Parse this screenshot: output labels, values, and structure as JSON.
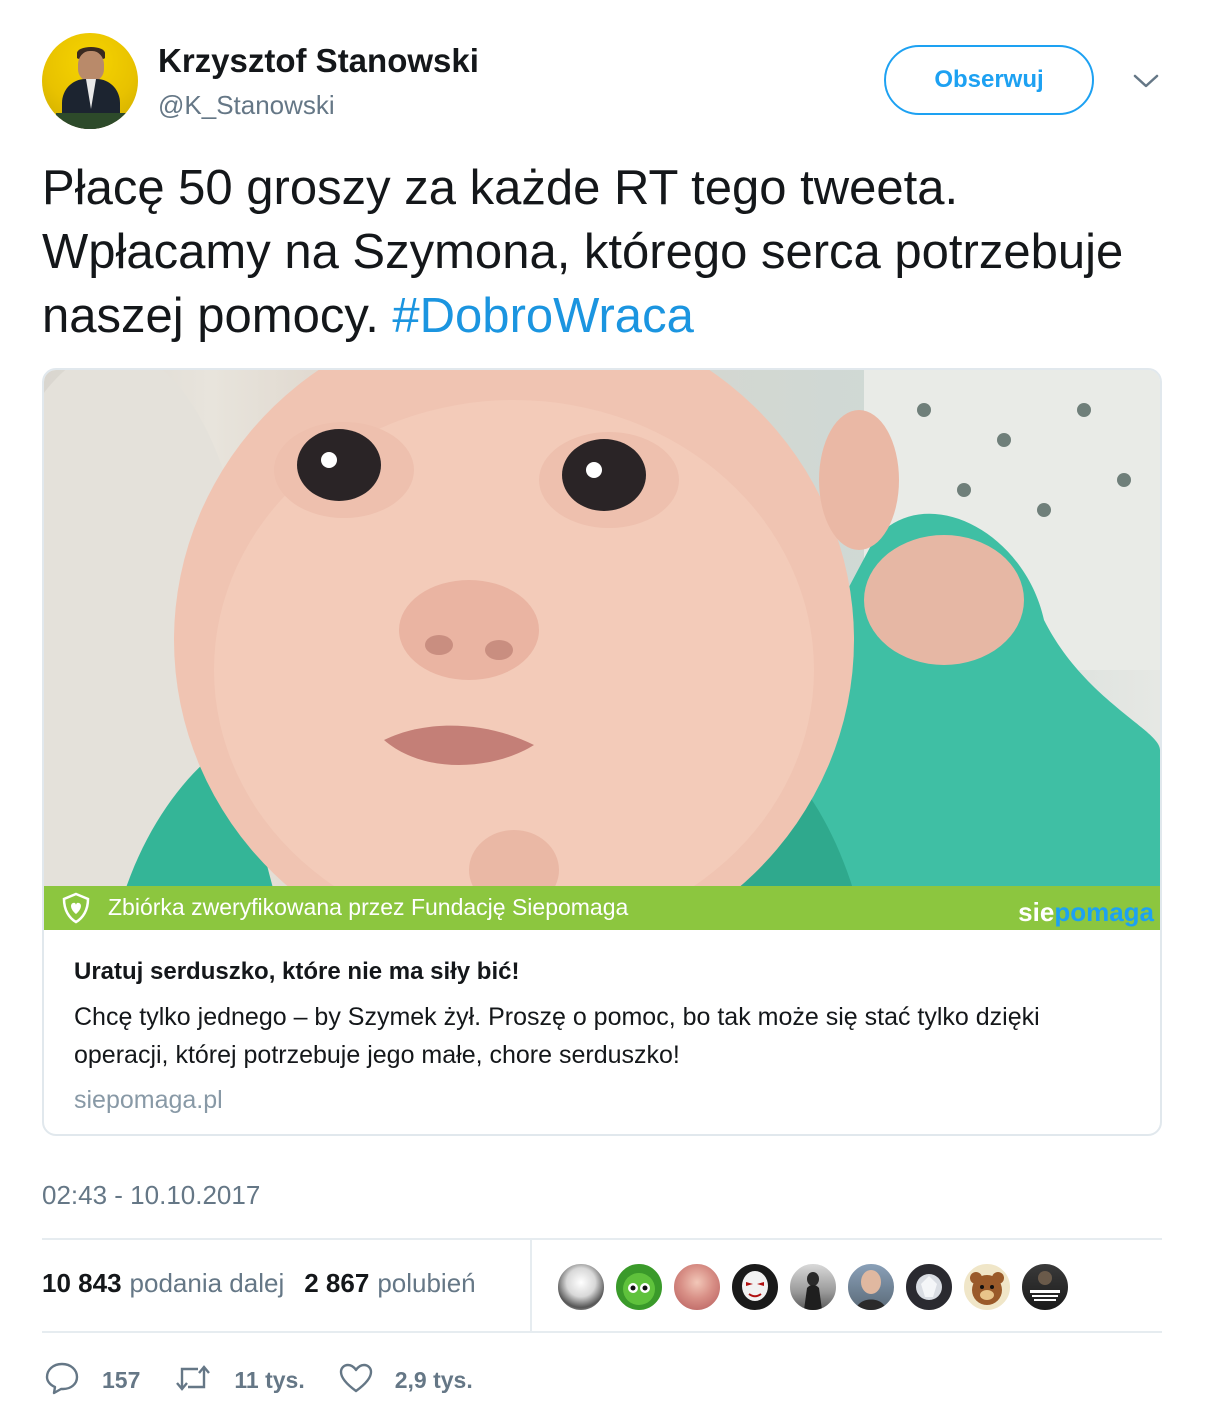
{
  "author": {
    "name": "Krzysztof Stanowski",
    "handle": "@K_Stanowski",
    "avatar_icon": "user-avatar"
  },
  "follow_label": "Obserwuj",
  "menu_icon": "chevron-down-icon",
  "tweet": {
    "text": "Płacę 50 groszy za każde RT tego tweeta. Wpłacamy na Szymona, którego serca potrzebuje naszej pomocy. ",
    "hashtag": "#DobroWraca"
  },
  "card": {
    "verify_text": "Zbiórka zweryfikowana przez Fundację Siepomaga",
    "brand_part1": "sie",
    "brand_part2": "pomaga",
    "title": "Uratuj serduszko, które nie ma siły bić!",
    "description": "Chcę tylko jednego – by Szymek żył. Proszę o pomoc, bo tak może się stać tylko dzięki operacji, której potrzebuje jego małe, chore serduszko!",
    "domain": "siepomaga.pl"
  },
  "timestamp": "02:43 - 10.10.2017",
  "stats": {
    "retweets_count": "10 843",
    "retweets_label": "podania dalej",
    "likes_count": "2 867",
    "likes_label": "polubień"
  },
  "likers_count": 9,
  "actions": {
    "reply_count": "157",
    "retweet_count": "11 tys.",
    "like_count": "2,9 tys."
  },
  "colors": {
    "accent": "#1da1f2",
    "hashtag": "#1b95e0",
    "verify_bar": "#8cc63f",
    "muted": "#657786"
  }
}
